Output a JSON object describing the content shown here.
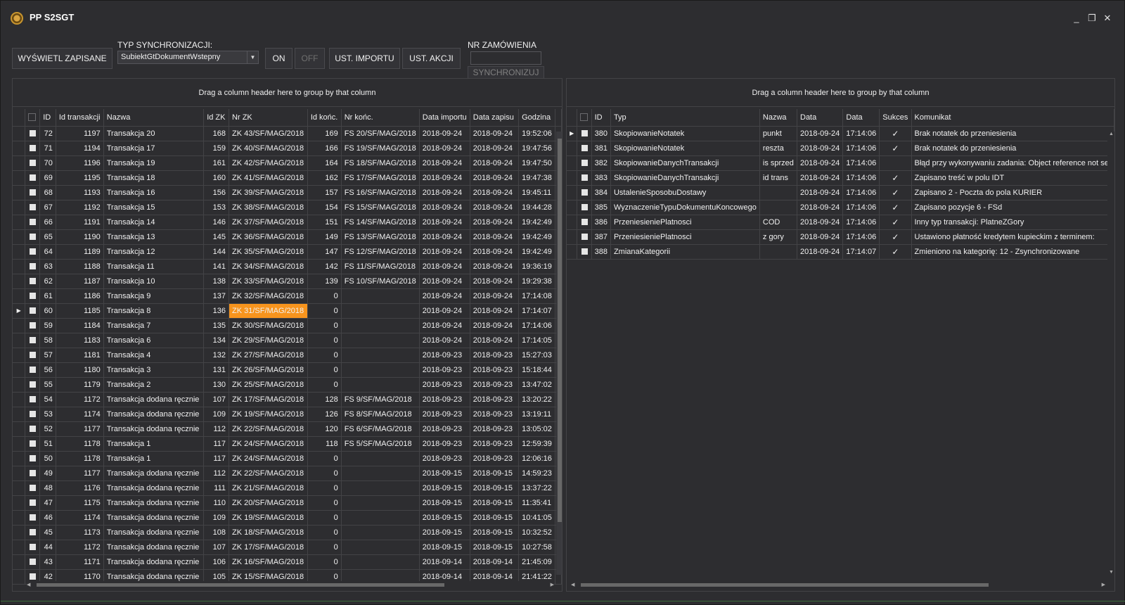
{
  "app": {
    "title": "PP S2SGT"
  },
  "window_controls": {
    "minimize": "_",
    "maximize": "❐",
    "close": "✕"
  },
  "toolbar": {
    "show_saved": "WYŚWIETL ZAPISANE",
    "sync_type_label": "TYP SYNCHRONIZACJI:",
    "sync_type_value": "SubiektGtDokumentWstepny",
    "on": "ON",
    "off": "OFF",
    "import_settings": "UST. IMPORTU",
    "action_settings": "UST. AKCJI",
    "order_no_label": "NR ZAMÓWIENIA",
    "order_no_value": "",
    "synchronize": "SYNCHRONIZUJ"
  },
  "left_grid": {
    "group_hint": "Drag a column header here to group by that column",
    "columns": [
      "ID",
      "Id transakcji",
      "Nazwa",
      "Id ZK",
      "Nr ZK",
      "Id końc.",
      "Nr końc.",
      "Data importu",
      "Data zapisu",
      "Godzina"
    ],
    "rows": [
      [
        "72",
        "1197",
        "Transakcja 20",
        "168",
        "ZK 43/SF/MAG/2018",
        "169",
        "FS 20/SF/MAG/2018",
        "2018-09-24",
        "2018-09-24",
        "19:52:06"
      ],
      [
        "71",
        "1194",
        "Transakcja 17",
        "159",
        "ZK 40/SF/MAG/2018",
        "166",
        "FS 19/SF/MAG/2018",
        "2018-09-24",
        "2018-09-24",
        "19:47:56"
      ],
      [
        "70",
        "1196",
        "Transakcja 19",
        "161",
        "ZK 42/SF/MAG/2018",
        "164",
        "FS 18/SF/MAG/2018",
        "2018-09-24",
        "2018-09-24",
        "19:47:50"
      ],
      [
        "69",
        "1195",
        "Transakcja 18",
        "160",
        "ZK 41/SF/MAG/2018",
        "162",
        "FS 17/SF/MAG/2018",
        "2018-09-24",
        "2018-09-24",
        "19:47:38"
      ],
      [
        "68",
        "1193",
        "Transakcja 16",
        "156",
        "ZK 39/SF/MAG/2018",
        "157",
        "FS 16/SF/MAG/2018",
        "2018-09-24",
        "2018-09-24",
        "19:45:11"
      ],
      [
        "67",
        "1192",
        "Transakcja 15",
        "153",
        "ZK 38/SF/MAG/2018",
        "154",
        "FS 15/SF/MAG/2018",
        "2018-09-24",
        "2018-09-24",
        "19:44:28"
      ],
      [
        "66",
        "1191",
        "Transakcja 14",
        "146",
        "ZK 37/SF/MAG/2018",
        "151",
        "FS 14/SF/MAG/2018",
        "2018-09-24",
        "2018-09-24",
        "19:42:49"
      ],
      [
        "65",
        "1190",
        "Transakcja 13",
        "145",
        "ZK 36/SF/MAG/2018",
        "149",
        "FS 13/SF/MAG/2018",
        "2018-09-24",
        "2018-09-24",
        "19:42:49"
      ],
      [
        "64",
        "1189",
        "Transakcja 12",
        "144",
        "ZK 35/SF/MAG/2018",
        "147",
        "FS 12/SF/MAG/2018",
        "2018-09-24",
        "2018-09-24",
        "19:42:49"
      ],
      [
        "63",
        "1188",
        "Transakcja 11",
        "141",
        "ZK 34/SF/MAG/2018",
        "142",
        "FS 11/SF/MAG/2018",
        "2018-09-24",
        "2018-09-24",
        "19:36:19"
      ],
      [
        "62",
        "1187",
        "Transakcja 10",
        "138",
        "ZK 33/SF/MAG/2018",
        "139",
        "FS 10/SF/MAG/2018",
        "2018-09-24",
        "2018-09-24",
        "19:29:38"
      ],
      [
        "61",
        "1186",
        "Transakcja 9",
        "137",
        "ZK 32/SF/MAG/2018",
        "0",
        "",
        "2018-09-24",
        "2018-09-24",
        "17:14:08"
      ],
      [
        "60",
        "1185",
        "Transakcja 8",
        "136",
        "ZK 31/SF/MAG/2018",
        "0",
        "",
        "2018-09-24",
        "2018-09-24",
        "17:14:07"
      ],
      [
        "59",
        "1184",
        "Transakcja 7",
        "135",
        "ZK 30/SF/MAG/2018",
        "0",
        "",
        "2018-09-24",
        "2018-09-24",
        "17:14:06"
      ],
      [
        "58",
        "1183",
        "Transakcja 6",
        "134",
        "ZK 29/SF/MAG/2018",
        "0",
        "",
        "2018-09-24",
        "2018-09-24",
        "17:14:05"
      ],
      [
        "57",
        "1181",
        "Transakcja 4",
        "132",
        "ZK 27/SF/MAG/2018",
        "0",
        "",
        "2018-09-23",
        "2018-09-23",
        "15:27:03"
      ],
      [
        "56",
        "1180",
        "Transakcja 3",
        "131",
        "ZK 26/SF/MAG/2018",
        "0",
        "",
        "2018-09-23",
        "2018-09-23",
        "15:18:44"
      ],
      [
        "55",
        "1179",
        "Transakcja 2",
        "130",
        "ZK 25/SF/MAG/2018",
        "0",
        "",
        "2018-09-23",
        "2018-09-23",
        "13:47:02"
      ],
      [
        "54",
        "1172",
        "Transakcja dodana ręcznie",
        "107",
        "ZK 17/SF/MAG/2018",
        "128",
        "FS 9/SF/MAG/2018",
        "2018-09-23",
        "2018-09-23",
        "13:20:22"
      ],
      [
        "53",
        "1174",
        "Transakcja dodana ręcznie",
        "109",
        "ZK 19/SF/MAG/2018",
        "126",
        "FS 8/SF/MAG/2018",
        "2018-09-23",
        "2018-09-23",
        "13:19:11"
      ],
      [
        "52",
        "1177",
        "Transakcja dodana ręcznie",
        "112",
        "ZK 22/SF/MAG/2018",
        "120",
        "FS 6/SF/MAG/2018",
        "2018-09-23",
        "2018-09-23",
        "13:05:02"
      ],
      [
        "51",
        "1178",
        "Transakcja 1",
        "117",
        "ZK 24/SF/MAG/2018",
        "118",
        "FS 5/SF/MAG/2018",
        "2018-09-23",
        "2018-09-23",
        "12:59:39"
      ],
      [
        "50",
        "1178",
        "Transakcja 1",
        "117",
        "ZK 24/SF/MAG/2018",
        "0",
        "",
        "2018-09-23",
        "2018-09-23",
        "12:06:16"
      ],
      [
        "49",
        "1177",
        "Transakcja dodana ręcznie",
        "112",
        "ZK 22/SF/MAG/2018",
        "0",
        "",
        "2018-09-15",
        "2018-09-15",
        "14:59:23"
      ],
      [
        "48",
        "1176",
        "Transakcja dodana ręcznie",
        "111",
        "ZK 21/SF/MAG/2018",
        "0",
        "",
        "2018-09-15",
        "2018-09-15",
        "13:37:22"
      ],
      [
        "47",
        "1175",
        "Transakcja dodana ręcznie",
        "110",
        "ZK 20/SF/MAG/2018",
        "0",
        "",
        "2018-09-15",
        "2018-09-15",
        "11:35:41"
      ],
      [
        "46",
        "1174",
        "Transakcja dodana ręcznie",
        "109",
        "ZK 19/SF/MAG/2018",
        "0",
        "",
        "2018-09-15",
        "2018-09-15",
        "10:41:05"
      ],
      [
        "45",
        "1173",
        "Transakcja dodana ręcznie",
        "108",
        "ZK 18/SF/MAG/2018",
        "0",
        "",
        "2018-09-15",
        "2018-09-15",
        "10:32:52"
      ],
      [
        "44",
        "1172",
        "Transakcja dodana ręcznie",
        "107",
        "ZK 17/SF/MAG/2018",
        "0",
        "",
        "2018-09-15",
        "2018-09-15",
        "10:27:58"
      ],
      [
        "43",
        "1171",
        "Transakcja dodana ręcznie",
        "106",
        "ZK 16/SF/MAG/2018",
        "0",
        "",
        "2018-09-14",
        "2018-09-14",
        "21:45:09"
      ],
      [
        "42",
        "1170",
        "Transakcja dodana ręcznie",
        "105",
        "ZK 15/SF/MAG/2018",
        "0",
        "",
        "2018-09-14",
        "2018-09-14",
        "21:41:22"
      ]
    ],
    "current_row_id": "60",
    "highlight_color": "#f7941d"
  },
  "right_grid": {
    "group_hint": "Drag a column header here to group by that column",
    "columns": [
      "ID",
      "Typ",
      "Nazwa",
      "Data",
      "Data",
      "Sukces",
      "Komunikat"
    ],
    "rows": [
      [
        "380",
        "SkopiowanieNotatek",
        "punkt",
        "2018-09-24",
        "17:14:06",
        true,
        "Brak notatek do przeniesienia"
      ],
      [
        "381",
        "SkopiowanieNotatek",
        "reszta",
        "2018-09-24",
        "17:14:06",
        true,
        "Brak notatek do przeniesienia"
      ],
      [
        "382",
        "SkopiowanieDanychTransakcji",
        "is sprzed",
        "2018-09-24",
        "17:14:06",
        false,
        "Błąd przy wykonywaniu zadania: Object reference not set"
      ],
      [
        "383",
        "SkopiowanieDanychTransakcji",
        "id trans",
        "2018-09-24",
        "17:14:06",
        true,
        "Zapisano treść w polu IDT"
      ],
      [
        "384",
        "UstalenieSposobuDostawy",
        "",
        "2018-09-24",
        "17:14:06",
        true,
        "Zapisano 2 - Poczta do pola KURIER"
      ],
      [
        "385",
        "WyznaczenieTypuDokumentuKoncowego",
        "",
        "2018-09-24",
        "17:14:06",
        true,
        "Zapisano pozycje 6 - FSd"
      ],
      [
        "386",
        "PrzeniesieniePlatnosci",
        "COD",
        "2018-09-24",
        "17:14:06",
        true,
        "Inny typ transakcji: PlatneZGory"
      ],
      [
        "387",
        "PrzeniesieniePlatnosci",
        "z gory",
        "2018-09-24",
        "17:14:06",
        true,
        "Ustawiono płatność kredytem kupieckim z terminem:"
      ],
      [
        "388",
        "ZmianaKategorii",
        "",
        "2018-09-24",
        "17:14:07",
        true,
        "Zmieniono na kategorię: 12 - Zsynchronizowane"
      ]
    ],
    "current_row_id": "380"
  }
}
